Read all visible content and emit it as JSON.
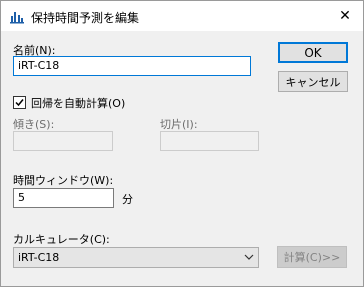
{
  "window": {
    "title": "保持時間予測を編集",
    "close_glyph": "✕"
  },
  "form": {
    "name_label": "名前(N):",
    "name_value": "iRT-C18",
    "auto_calc_label": "回帰を自動計算(O)",
    "auto_calc_checked": true,
    "slope_label": "傾き(S):",
    "slope_value": "",
    "intercept_label": "切片(I):",
    "intercept_value": "",
    "window_label": "時間ウィンドウ(W):",
    "window_value": "5",
    "window_unit": "分",
    "calculator_label": "カルキュレータ(C):",
    "calculator_value": "iRT-C18"
  },
  "buttons": {
    "ok": "OK",
    "cancel": "キャンセル",
    "calculate": "計算(C)>>"
  },
  "icons": {
    "app": "chart-bars-icon",
    "close": "close-icon",
    "check": "check-icon",
    "dropdown": "chevron-down-icon"
  },
  "colors": {
    "focus_border": "#0078d7",
    "icon_blue": "#1e5fa8"
  }
}
